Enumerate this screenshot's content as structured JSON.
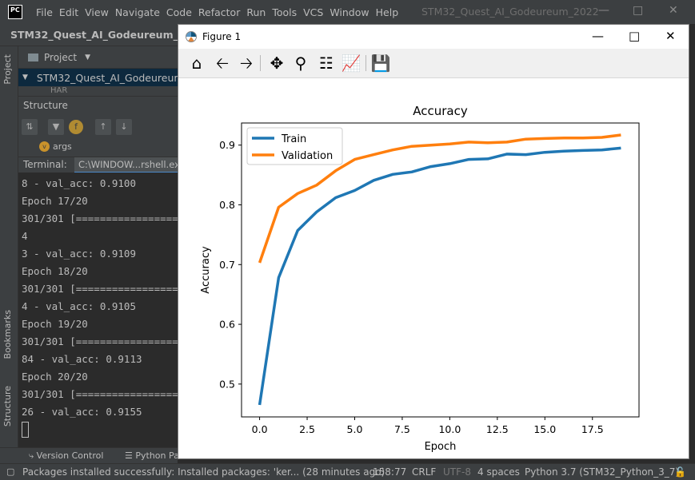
{
  "ide": {
    "logo": "PC",
    "menu": [
      "File",
      "Edit",
      "View",
      "Navigate",
      "Code",
      "Refactor",
      "Run",
      "Tools",
      "VCS",
      "Window",
      "Help"
    ],
    "title": "STM32_Quest_AI_Godeureum_2022",
    "project_name": "STM32_Quest_AI_Godeureum_2022",
    "project_panel_label": "Project",
    "tree_root": "STM32_Quest_AI_Godeureum_2022",
    "tree_child": "HAR",
    "structure_title": "Structure",
    "structure_item": "args",
    "structure_item_badge": "v",
    "terminal_label": "Terminal:",
    "terminal_tab": "C:\\WINDOW...rshell.exe",
    "left_tabs": {
      "project": "Project",
      "bookmarks": "Bookmarks",
      "structure": "Structure"
    },
    "terminal_lines": [
      "8 - val_acc: 0.9100",
      "Epoch 17/20",
      "301/301 [==============================",
      "4",
      "3 - val_acc: 0.9109",
      "Epoch 18/20",
      "301/301 [==============================",
      "4 - val_acc: 0.9105",
      "Epoch 19/20",
      "301/301 [==============================",
      "84 - val_acc: 0.9113",
      "Epoch 20/20",
      "301/301 [==============================",
      "26 - val_acc: 0.9155"
    ],
    "bottom_tabs": {
      "version_control": "Version Control",
      "python_packages": "Python Pa"
    },
    "status": {
      "message": "Packages installed successfully: Installed packages: 'ker... (28 minutes ago)",
      "position": "158:77",
      "line_sep": "CRLF",
      "encoding": "UTF-8",
      "indent": "4 spaces",
      "interpreter": "Python 3.7 (STM32_Python_3_7)"
    }
  },
  "figure": {
    "window_title": "Figure 1",
    "toolbar": [
      "home-icon",
      "back-icon",
      "forward-icon",
      "pan-icon",
      "zoom-icon",
      "subplots-icon",
      "axes-edit-icon",
      "save-icon"
    ]
  },
  "chart_data": {
    "type": "line",
    "title": "Accuracy",
    "xlabel": "Epoch",
    "ylabel": "Accuracy",
    "xlim": [
      -0.95,
      19.95
    ],
    "ylim": [
      0.445,
      0.937
    ],
    "xticks": [
      0.0,
      2.5,
      5.0,
      7.5,
      10.0,
      12.5,
      15.0,
      17.5
    ],
    "xtick_labels": [
      "0.0",
      "2.5",
      "5.0",
      "7.5",
      "10.0",
      "12.5",
      "15.0",
      "17.5"
    ],
    "yticks": [
      0.5,
      0.6,
      0.7,
      0.8,
      0.9
    ],
    "ytick_labels": [
      "0.5",
      "0.6",
      "0.7",
      "0.8",
      "0.9"
    ],
    "legend_position": "upper-left",
    "grid": false,
    "x": [
      0,
      1,
      2,
      3,
      4,
      5,
      6,
      7,
      8,
      9,
      10,
      11,
      12,
      13,
      14,
      15,
      16,
      17,
      18,
      19
    ],
    "series": [
      {
        "name": "Train",
        "color": "#1f77b4",
        "values": [
          0.465,
          0.678,
          0.757,
          0.788,
          0.812,
          0.824,
          0.841,
          0.851,
          0.855,
          0.864,
          0.869,
          0.876,
          0.877,
          0.885,
          0.884,
          0.888,
          0.89,
          0.891,
          0.892,
          0.895
        ]
      },
      {
        "name": "Validation",
        "color": "#ff7f0e",
        "values": [
          0.703,
          0.796,
          0.819,
          0.833,
          0.857,
          0.876,
          0.884,
          0.892,
          0.898,
          0.9,
          0.902,
          0.905,
          0.904,
          0.905,
          0.91,
          0.911,
          0.912,
          0.912,
          0.913,
          0.917
        ]
      }
    ]
  }
}
